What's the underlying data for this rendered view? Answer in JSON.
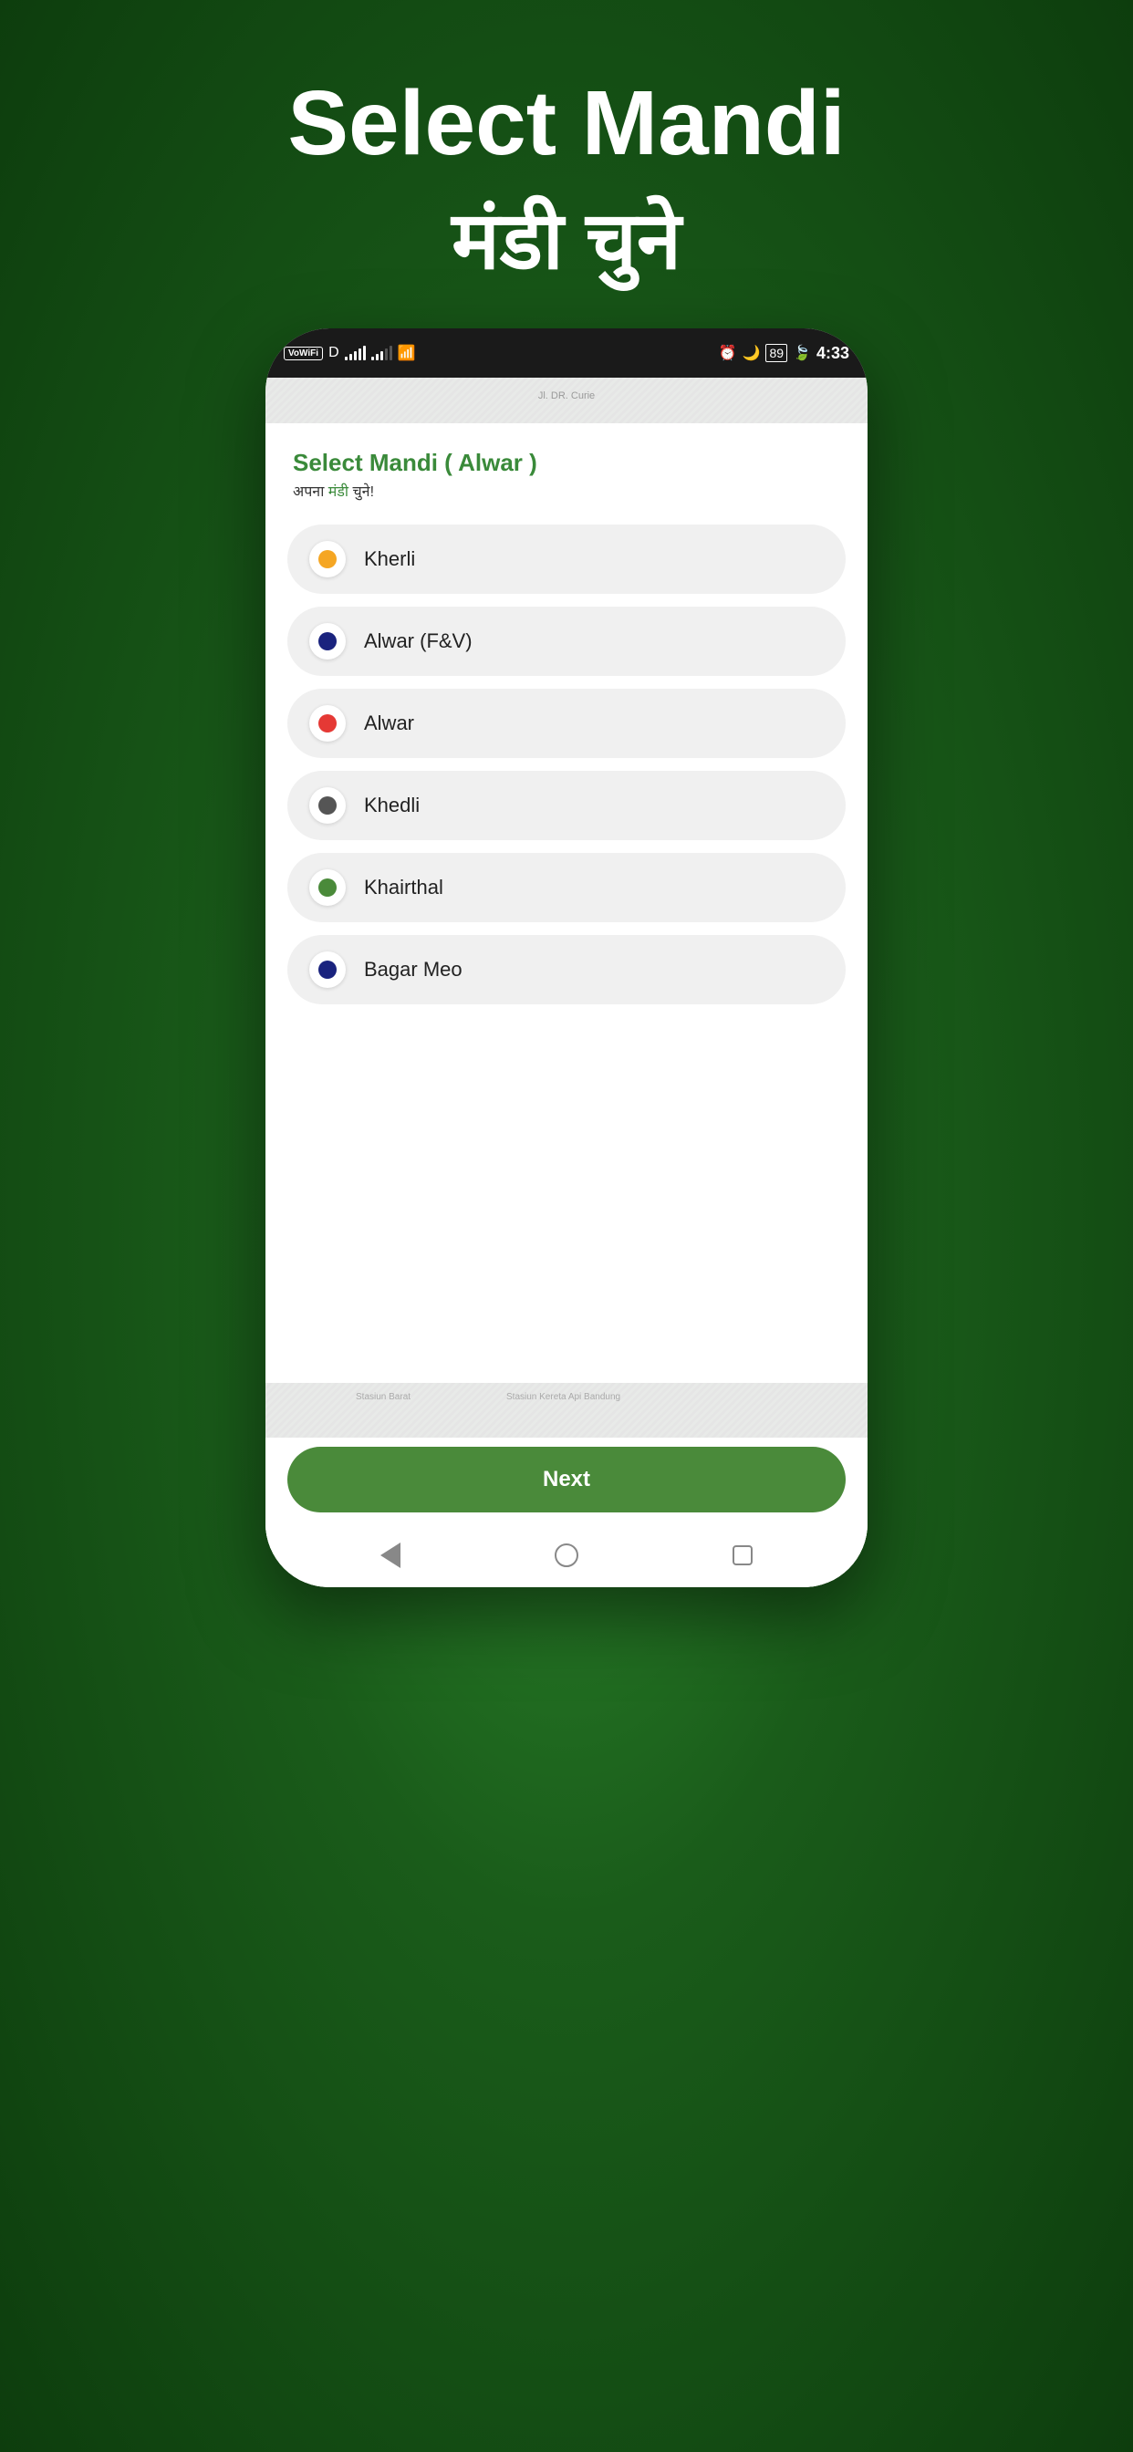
{
  "header": {
    "title": "Select Mandi",
    "subtitle": "मंडी चुने"
  },
  "status_bar": {
    "vowifi": "VoWiFi",
    "time": "4:33",
    "battery": "89"
  },
  "screen": {
    "title_static": "Select",
    "title_green": "Mandi  ( Alwar )",
    "subtitle_hindi_prefix": "अपना ",
    "subtitle_hindi_green": "मंडी",
    "subtitle_hindi_suffix": " चुने!"
  },
  "mandi_items": [
    {
      "name": "Kherli",
      "dot_color": "#f5a623"
    },
    {
      "name": "Alwar (F&V)",
      "dot_color": "#1a237e"
    },
    {
      "name": "Alwar",
      "dot_color": "#e53935"
    },
    {
      "name": "Khedli",
      "dot_color": "#555"
    },
    {
      "name": "Khairthal",
      "dot_color": "#4a8a3a"
    },
    {
      "name": "Bagar Meo",
      "dot_color": "#1a237e"
    }
  ],
  "next_button": {
    "label": "Next"
  }
}
